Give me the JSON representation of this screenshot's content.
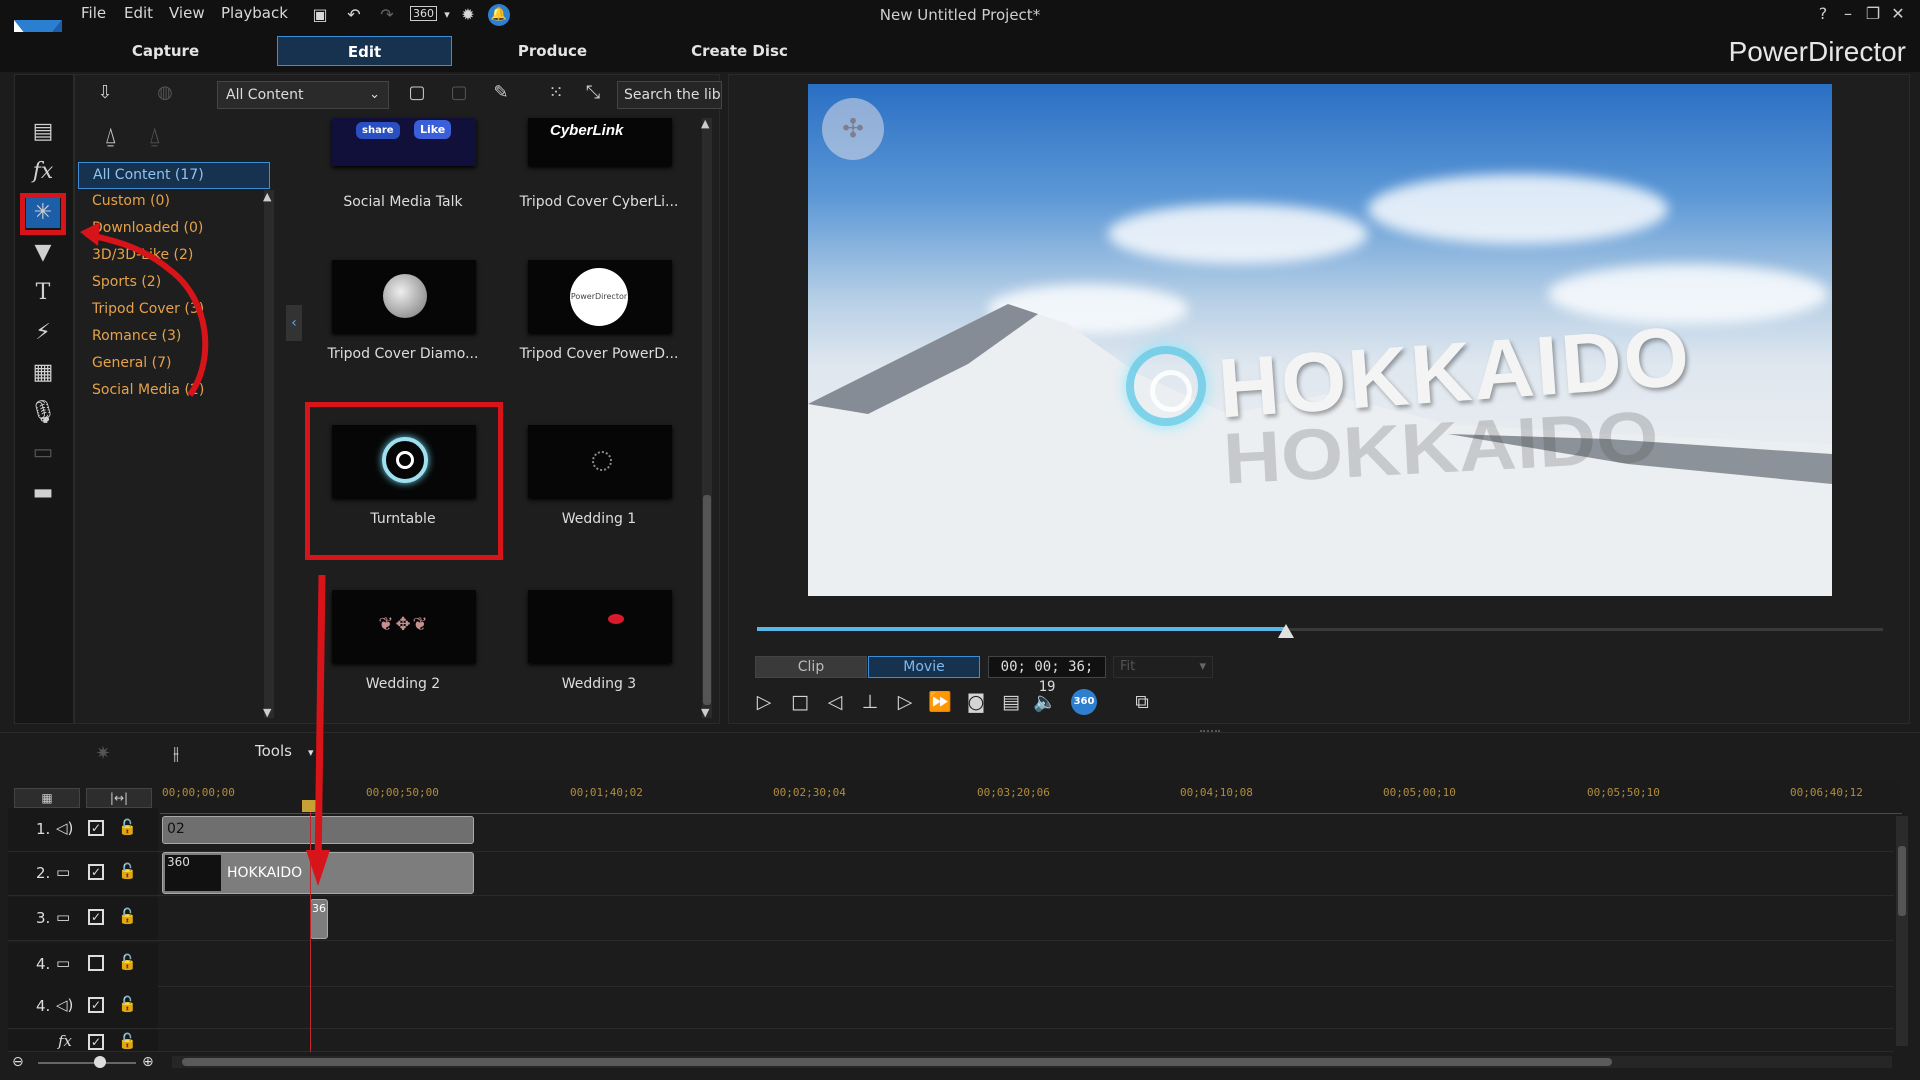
{
  "app": {
    "menu": [
      "File",
      "Edit",
      "View",
      "Playback"
    ],
    "window_title": "New Untitled Project*",
    "brand": "PowerDirector",
    "toolbar_360_label": "360",
    "win_controls": [
      "?",
      "–",
      "❐",
      "✕"
    ]
  },
  "modes": {
    "capture": "Capture",
    "edit": "Edit",
    "produce": "Produce",
    "create_disc": "Create Disc"
  },
  "library": {
    "content_filter": "All Content",
    "search_placeholder": "Search the libra",
    "categories": [
      {
        "label": "All Content  (17)",
        "active": true
      },
      {
        "label": "Custom  (0)"
      },
      {
        "label": "Downloaded  (0)"
      },
      {
        "label": "3D/3D-Like  (2)"
      },
      {
        "label": "Sports  (2)"
      },
      {
        "label": "Tripod Cover  (3)"
      },
      {
        "label": "Romance  (3)"
      },
      {
        "label": "General  (7)"
      },
      {
        "label": "Social Media  (2)"
      }
    ],
    "templates": [
      {
        "name": "Social Media Talk",
        "thumb": "social-media"
      },
      {
        "name": "Tripod Cover CyberLi...",
        "thumb": "cyberlink"
      },
      {
        "name": "Tripod Cover Diamo...",
        "thumb": "moon"
      },
      {
        "name": "Tripod Cover PowerD...",
        "thumb": "powerdirector-disc"
      },
      {
        "name": "Turntable",
        "thumb": "turntable",
        "highlighted": true
      },
      {
        "name": "Wedding 1",
        "thumb": "ring"
      },
      {
        "name": "Wedding 2",
        "thumb": "ornament"
      },
      {
        "name": "Wedding 3",
        "thumb": "lips"
      }
    ],
    "thumb_text": {
      "share": "share",
      "like": "Like",
      "cyberlink": "CyberLink",
      "powerdirector": "PowerDirector"
    }
  },
  "preview": {
    "overlay_title": "HOKKAIDO",
    "clip_label": "Clip",
    "movie_label": "Movie",
    "timecode": "00; 00; 36; 19",
    "fit_label": "Fit",
    "progress": 0.47,
    "btn_360": "360"
  },
  "timeline": {
    "tools_label": "Tools",
    "ruler_ticks": [
      "00;00;00;00",
      "00;00;50;00",
      "00;01;40;02",
      "00;02;30;04",
      "00;03;20;06",
      "00;04;10;08",
      "00;05;00;10",
      "00;05;50;10",
      "00;06;40;12"
    ],
    "tracks": [
      {
        "num": "1.",
        "type": "audio-icon",
        "checked": true
      },
      {
        "num": "2.",
        "type": "video-icon",
        "checked": true
      },
      {
        "num": "3.",
        "type": "video-icon",
        "checked": true
      },
      {
        "num": "4.",
        "type": "video-icon",
        "checked": false
      },
      {
        "num": "4.",
        "type": "audio-icon",
        "checked": true
      },
      {
        "num": "fx",
        "type": "fx-icon",
        "checked": true
      }
    ],
    "clips": {
      "audio_clip_label": "02",
      "video_clip_badge": "360",
      "video_clip_name": "HOKKAIDO",
      "small_clip_badge": "36"
    }
  },
  "colors": {
    "accent": "#3a8fd8",
    "highlight_red": "#d8141b",
    "category_text": "#e5a24a"
  }
}
